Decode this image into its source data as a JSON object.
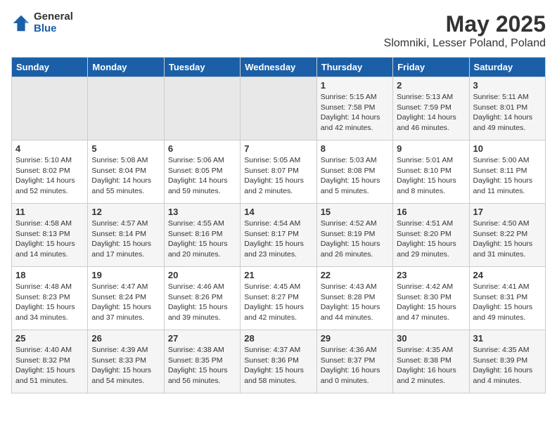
{
  "header": {
    "logo_general": "General",
    "logo_blue": "Blue",
    "title": "May 2025",
    "subtitle": "Slomniki, Lesser Poland, Poland"
  },
  "days_of_week": [
    "Sunday",
    "Monday",
    "Tuesday",
    "Wednesday",
    "Thursday",
    "Friday",
    "Saturday"
  ],
  "weeks": [
    [
      {
        "day": "",
        "info": ""
      },
      {
        "day": "",
        "info": ""
      },
      {
        "day": "",
        "info": ""
      },
      {
        "day": "",
        "info": ""
      },
      {
        "day": "1",
        "info": "Sunrise: 5:15 AM\nSunset: 7:58 PM\nDaylight: 14 hours\nand 42 minutes."
      },
      {
        "day": "2",
        "info": "Sunrise: 5:13 AM\nSunset: 7:59 PM\nDaylight: 14 hours\nand 46 minutes."
      },
      {
        "day": "3",
        "info": "Sunrise: 5:11 AM\nSunset: 8:01 PM\nDaylight: 14 hours\nand 49 minutes."
      }
    ],
    [
      {
        "day": "4",
        "info": "Sunrise: 5:10 AM\nSunset: 8:02 PM\nDaylight: 14 hours\nand 52 minutes."
      },
      {
        "day": "5",
        "info": "Sunrise: 5:08 AM\nSunset: 8:04 PM\nDaylight: 14 hours\nand 55 minutes."
      },
      {
        "day": "6",
        "info": "Sunrise: 5:06 AM\nSunset: 8:05 PM\nDaylight: 14 hours\nand 59 minutes."
      },
      {
        "day": "7",
        "info": "Sunrise: 5:05 AM\nSunset: 8:07 PM\nDaylight: 15 hours\nand 2 minutes."
      },
      {
        "day": "8",
        "info": "Sunrise: 5:03 AM\nSunset: 8:08 PM\nDaylight: 15 hours\nand 5 minutes."
      },
      {
        "day": "9",
        "info": "Sunrise: 5:01 AM\nSunset: 8:10 PM\nDaylight: 15 hours\nand 8 minutes."
      },
      {
        "day": "10",
        "info": "Sunrise: 5:00 AM\nSunset: 8:11 PM\nDaylight: 15 hours\nand 11 minutes."
      }
    ],
    [
      {
        "day": "11",
        "info": "Sunrise: 4:58 AM\nSunset: 8:13 PM\nDaylight: 15 hours\nand 14 minutes."
      },
      {
        "day": "12",
        "info": "Sunrise: 4:57 AM\nSunset: 8:14 PM\nDaylight: 15 hours\nand 17 minutes."
      },
      {
        "day": "13",
        "info": "Sunrise: 4:55 AM\nSunset: 8:16 PM\nDaylight: 15 hours\nand 20 minutes."
      },
      {
        "day": "14",
        "info": "Sunrise: 4:54 AM\nSunset: 8:17 PM\nDaylight: 15 hours\nand 23 minutes."
      },
      {
        "day": "15",
        "info": "Sunrise: 4:52 AM\nSunset: 8:19 PM\nDaylight: 15 hours\nand 26 minutes."
      },
      {
        "day": "16",
        "info": "Sunrise: 4:51 AM\nSunset: 8:20 PM\nDaylight: 15 hours\nand 29 minutes."
      },
      {
        "day": "17",
        "info": "Sunrise: 4:50 AM\nSunset: 8:22 PM\nDaylight: 15 hours\nand 31 minutes."
      }
    ],
    [
      {
        "day": "18",
        "info": "Sunrise: 4:48 AM\nSunset: 8:23 PM\nDaylight: 15 hours\nand 34 minutes."
      },
      {
        "day": "19",
        "info": "Sunrise: 4:47 AM\nSunset: 8:24 PM\nDaylight: 15 hours\nand 37 minutes."
      },
      {
        "day": "20",
        "info": "Sunrise: 4:46 AM\nSunset: 8:26 PM\nDaylight: 15 hours\nand 39 minutes."
      },
      {
        "day": "21",
        "info": "Sunrise: 4:45 AM\nSunset: 8:27 PM\nDaylight: 15 hours\nand 42 minutes."
      },
      {
        "day": "22",
        "info": "Sunrise: 4:43 AM\nSunset: 8:28 PM\nDaylight: 15 hours\nand 44 minutes."
      },
      {
        "day": "23",
        "info": "Sunrise: 4:42 AM\nSunset: 8:30 PM\nDaylight: 15 hours\nand 47 minutes."
      },
      {
        "day": "24",
        "info": "Sunrise: 4:41 AM\nSunset: 8:31 PM\nDaylight: 15 hours\nand 49 minutes."
      }
    ],
    [
      {
        "day": "25",
        "info": "Sunrise: 4:40 AM\nSunset: 8:32 PM\nDaylight: 15 hours\nand 51 minutes."
      },
      {
        "day": "26",
        "info": "Sunrise: 4:39 AM\nSunset: 8:33 PM\nDaylight: 15 hours\nand 54 minutes."
      },
      {
        "day": "27",
        "info": "Sunrise: 4:38 AM\nSunset: 8:35 PM\nDaylight: 15 hours\nand 56 minutes."
      },
      {
        "day": "28",
        "info": "Sunrise: 4:37 AM\nSunset: 8:36 PM\nDaylight: 15 hours\nand 58 minutes."
      },
      {
        "day": "29",
        "info": "Sunrise: 4:36 AM\nSunset: 8:37 PM\nDaylight: 16 hours\nand 0 minutes."
      },
      {
        "day": "30",
        "info": "Sunrise: 4:35 AM\nSunset: 8:38 PM\nDaylight: 16 hours\nand 2 minutes."
      },
      {
        "day": "31",
        "info": "Sunrise: 4:35 AM\nSunset: 8:39 PM\nDaylight: 16 hours\nand 4 minutes."
      }
    ]
  ]
}
